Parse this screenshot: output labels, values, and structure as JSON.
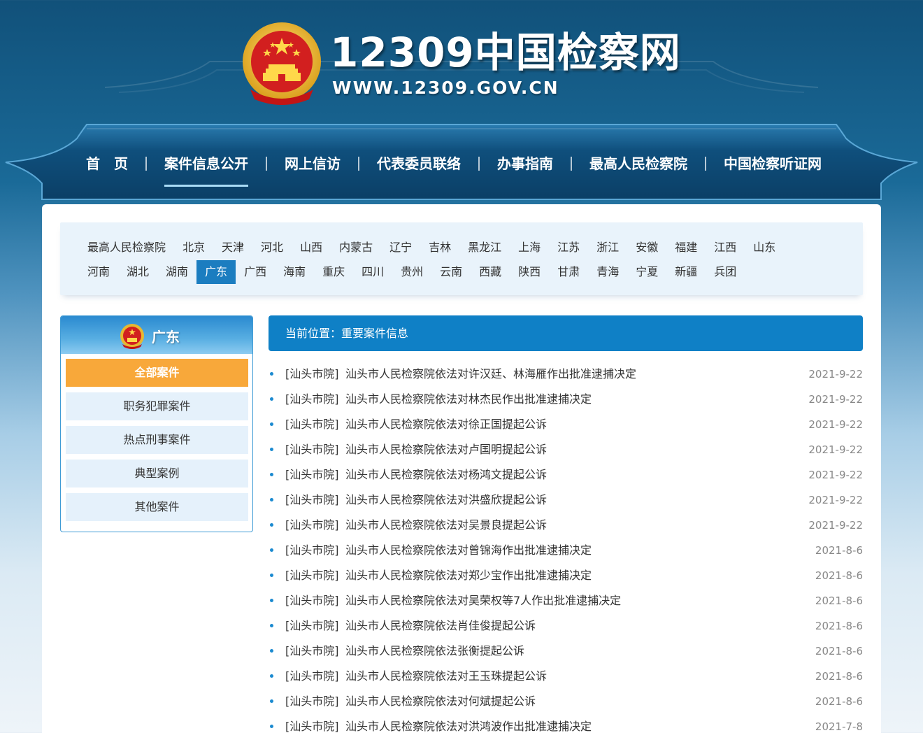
{
  "header": {
    "title": "12309中国检察网",
    "url": "WWW.12309.GOV.CN"
  },
  "nav": [
    {
      "label": "首　页"
    },
    {
      "label": "案件信息公开",
      "active": true
    },
    {
      "label": "网上信访"
    },
    {
      "label": "代表委员联络"
    },
    {
      "label": "办事指南"
    },
    {
      "label": "最高人民检察院"
    },
    {
      "label": "中国检察听证网"
    }
  ],
  "provinces": {
    "row1": [
      "最高人民检察院",
      "北京",
      "天津",
      "河北",
      "山西",
      "内蒙古",
      "辽宁",
      "吉林",
      "黑龙江",
      "上海",
      "江苏",
      "浙江",
      "安徽",
      "福建",
      "江西",
      "山东"
    ],
    "row2": [
      "河南",
      "湖北",
      "湖南",
      "广东",
      "广西",
      "海南",
      "重庆",
      "四川",
      "贵州",
      "云南",
      "西藏",
      "陕西",
      "甘肃",
      "青海",
      "宁夏",
      "新疆",
      "兵团"
    ],
    "selected": "广东"
  },
  "sidebar": {
    "title": "广东",
    "items": [
      {
        "label": "全部案件",
        "active": true
      },
      {
        "label": "职务犯罪案件"
      },
      {
        "label": "热点刑事案件"
      },
      {
        "label": "典型案例"
      },
      {
        "label": "其他案件"
      }
    ]
  },
  "breadcrumb": {
    "prefix": "当前位置：",
    "current": "重要案件信息"
  },
  "news": [
    {
      "tag": "[汕头市院]",
      "title": "汕头市人民检察院依法对许汉廷、林海雁作出批准逮捕决定",
      "date": "2021-9-22"
    },
    {
      "tag": "[汕头市院]",
      "title": "汕头市人民检察院依法对林杰民作出批准逮捕决定",
      "date": "2021-9-22"
    },
    {
      "tag": "[汕头市院]",
      "title": "汕头市人民检察院依法对徐正国提起公诉",
      "date": "2021-9-22"
    },
    {
      "tag": "[汕头市院]",
      "title": "汕头市人民检察院依法对卢国明提起公诉",
      "date": "2021-9-22"
    },
    {
      "tag": "[汕头市院]",
      "title": "汕头市人民检察院依法对杨鸿文提起公诉",
      "date": "2021-9-22"
    },
    {
      "tag": "[汕头市院]",
      "title": "汕头市人民检察院依法对洪盛欣提起公诉",
      "date": "2021-9-22"
    },
    {
      "tag": "[汕头市院]",
      "title": "汕头市人民检察院依法对吴景良提起公诉",
      "date": "2021-9-22"
    },
    {
      "tag": "[汕头市院]",
      "title": "汕头市人民检察院依法对曾锦海作出批准逮捕决定",
      "date": "2021-8-6"
    },
    {
      "tag": "[汕头市院]",
      "title": "汕头市人民检察院依法对郑少宝作出批准逮捕决定",
      "date": "2021-8-6"
    },
    {
      "tag": "[汕头市院]",
      "title": "汕头市人民检察院依法对吴荣权等7人作出批准逮捕决定",
      "date": "2021-8-6"
    },
    {
      "tag": "[汕头市院]",
      "title": "汕头市人民检察院依法肖佳俊提起公诉",
      "date": "2021-8-6"
    },
    {
      "tag": "[汕头市院]",
      "title": "汕头市人民检察院依法张衡提起公诉",
      "date": "2021-8-6"
    },
    {
      "tag": "[汕头市院]",
      "title": "汕头市人民检察院依法对王玉珠提起公诉",
      "date": "2021-8-6"
    },
    {
      "tag": "[汕头市院]",
      "title": "汕头市人民检察院依法对何斌提起公诉",
      "date": "2021-8-6"
    },
    {
      "tag": "[汕头市院]",
      "title": "汕头市人民检察院依法对洪鸿波作出批准逮捕决定",
      "date": "2021-7-8"
    }
  ],
  "colors": {
    "nav_bg": "#0f4d78",
    "accent": "#0f80c6",
    "selected_province": "#1b7dc0",
    "sidebar_active": "#f8a83a",
    "sidebar_item_bg": "#e5f1fb"
  }
}
